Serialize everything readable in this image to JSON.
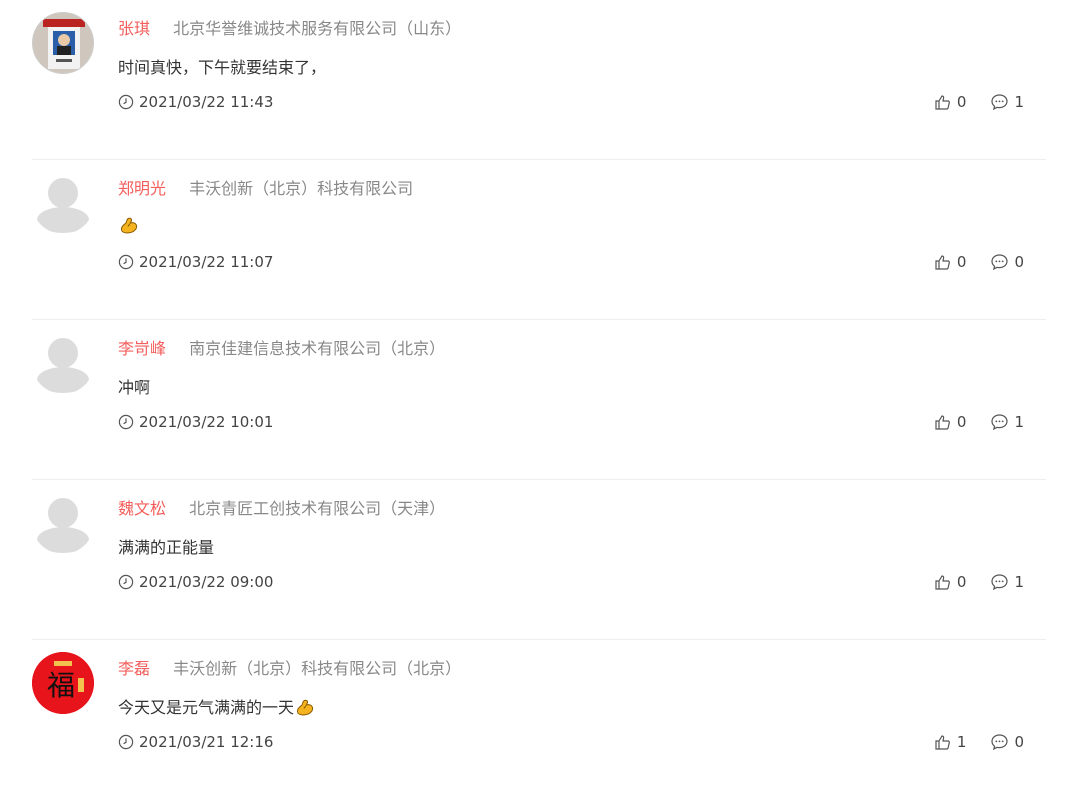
{
  "comments": [
    {
      "name": "张琪",
      "company": "北京华誉维诚技术服务有限公司（山东）",
      "content": "时间真快，下午就要结束了，",
      "time": "2021/03/22 11:43",
      "likes": "0",
      "replies": "1",
      "avatar": "photo",
      "emoji": false
    },
    {
      "name": "郑明光",
      "company": "丰沃创新（北京）科技有限公司",
      "content": "",
      "time": "2021/03/22 11:07",
      "likes": "0",
      "replies": "0",
      "avatar": "default",
      "emoji": true
    },
    {
      "name": "李岢峰",
      "company": "南京佳建信息技术有限公司（北京）",
      "content": "冲啊",
      "time": "2021/03/22 10:01",
      "likes": "0",
      "replies": "1",
      "avatar": "default",
      "emoji": false
    },
    {
      "name": "魏文松",
      "company": "北京青匠工创技术有限公司（天津）",
      "content": "满满的正能量",
      "time": "2021/03/22 09:00",
      "likes": "0",
      "replies": "1",
      "avatar": "default",
      "emoji": false
    },
    {
      "name": "李磊",
      "company": "丰沃创新（北京）科技有限公司（北京）",
      "content": "今天又是元气满满的一天",
      "time": "2021/03/21 12:16",
      "likes": "1",
      "replies": "0",
      "avatar": "fu",
      "emoji": true
    }
  ],
  "avatar_fu_text": "福",
  "icons": {
    "time": "clock-icon",
    "like": "thumbs-up-icon",
    "reply": "comment-icon",
    "emoji": "flexed-biceps-emoji"
  },
  "colors": {
    "name": "#f25f5c",
    "company": "#888888",
    "divider": "#eeeeee",
    "avatar_default": "#dcdcdc",
    "fu_red": "#e8141b"
  }
}
